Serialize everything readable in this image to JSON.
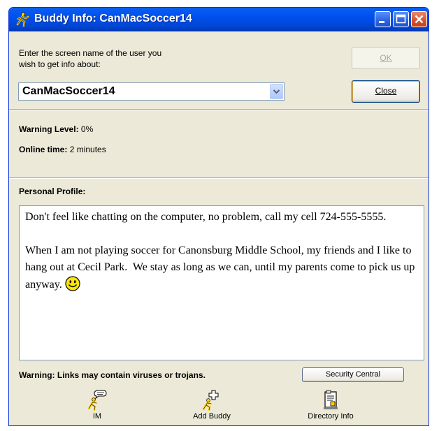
{
  "window": {
    "title": "Buddy Info: CanMacSoccer14",
    "icons": {
      "app": "running-man-icon",
      "minimize": "minimize-icon",
      "maximize": "maximize-icon",
      "close": "close-x-icon"
    }
  },
  "lookup": {
    "prompt_line1": "Enter the screen name of the user you",
    "prompt_line2": "wish to get info about:",
    "screen_name_value": "CanMacSoccer14",
    "ok_label": "OK",
    "close_label": "Close"
  },
  "status": {
    "warning_level_label": "Warning Level:",
    "warning_level_value": "0%",
    "online_time_label": "Online time:",
    "online_time_value": "2 minutes"
  },
  "profile": {
    "heading": "Personal Profile:",
    "text": "Don't feel like chatting on the computer, no problem, call my cell 724-555-5555.\n\nWhen I am not playing soccer for Canonsburg Middle School, my friends and I like to hang out at Cecil Park.  We stay as long as we can, until my parents come to pick us up anyway.",
    "emoticon": "smiley-icon"
  },
  "footer": {
    "warning_text": "Warning: Links may contain viruses or trojans.",
    "security_button": "Security Central"
  },
  "actions": [
    {
      "label": "IM",
      "icon": "im-icon"
    },
    {
      "label": "Add Buddy",
      "icon": "add-buddy-icon"
    },
    {
      "label": "Directory Info",
      "icon": "directory-info-icon"
    }
  ],
  "colors": {
    "title_bar": "#0054e3",
    "window_bg": "#ece9d8",
    "close_button": "#d6532e",
    "smiley": "#ffe600"
  }
}
